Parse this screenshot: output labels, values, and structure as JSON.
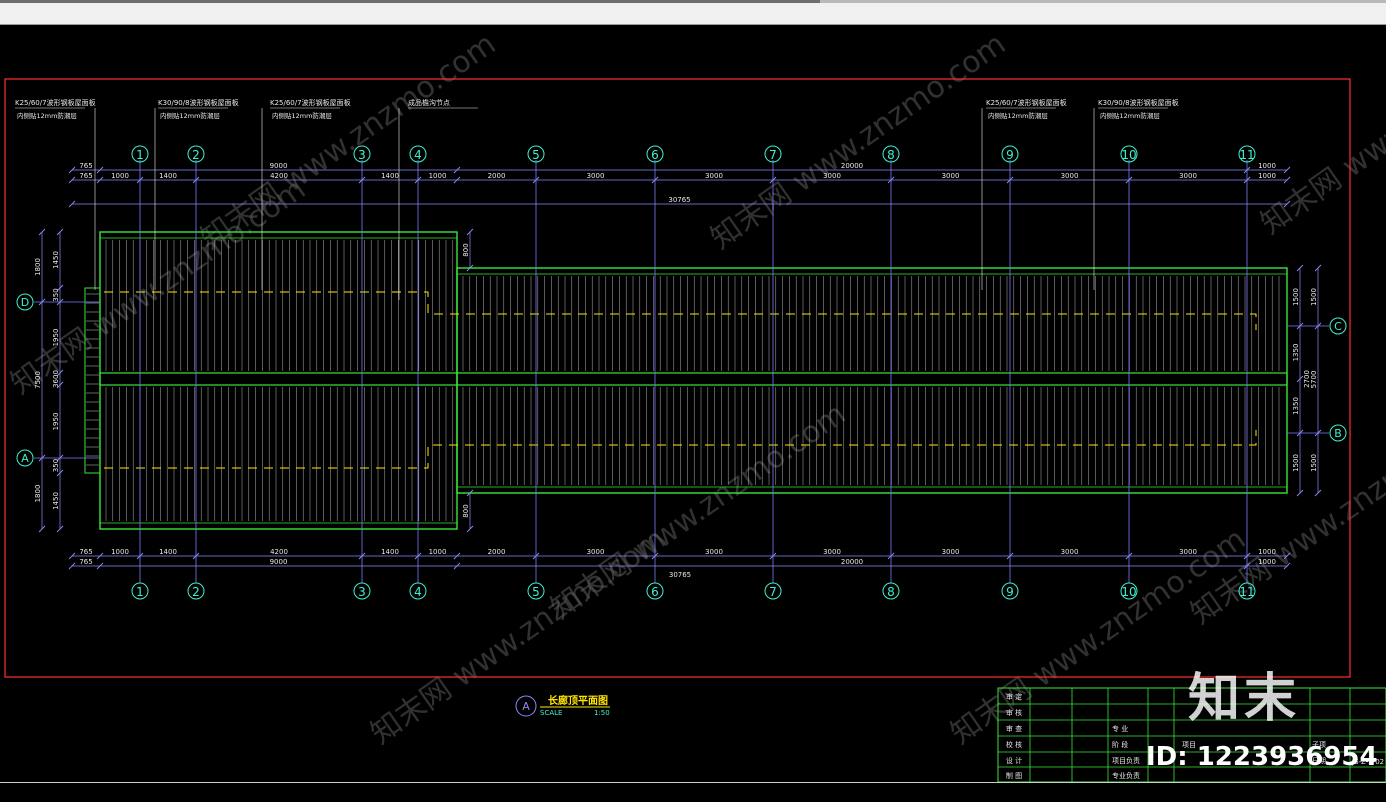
{
  "drawing": {
    "axes_top": [
      "1",
      "2",
      "3",
      "4",
      "5",
      "6",
      "7",
      "8",
      "9",
      "10",
      "11"
    ],
    "axes_bottom": [
      "1",
      "2",
      "3",
      "4",
      "5",
      "6",
      "7",
      "8",
      "9",
      "10",
      "11"
    ],
    "dim_top_row1": [
      "765",
      "9000",
      "20000",
      "1000"
    ],
    "dim_top_row2": [
      "765",
      "1000",
      "1400",
      "4200",
      "1400",
      "1000",
      "2000",
      "3000",
      "3000",
      "3000",
      "3000",
      "3000",
      "3000",
      "1000"
    ],
    "dim_total": "30765",
    "dim_bottom_row1": [
      "765",
      "1000",
      "1400",
      "4200",
      "1400",
      "1000",
      "2000",
      "3000",
      "3000",
      "3000",
      "3000",
      "3000",
      "3000",
      "1000"
    ],
    "dim_bottom_row2": [
      "765",
      "9000",
      "20000",
      "1000"
    ],
    "left_axes": [
      "D",
      "A"
    ],
    "right_axes": [
      "C",
      "B"
    ],
    "left_dims": [
      "1450",
      "1800",
      "350",
      "1950",
      "3600",
      "7500",
      "1950",
      "350",
      "1450",
      "1800"
    ],
    "right_dims": [
      "1500",
      "1500",
      "1350",
      "2700",
      "5700",
      "1350",
      "1500",
      "1500"
    ],
    "step_dims": [
      "800",
      "800"
    ],
    "callouts": [
      {
        "line1": "K25/60/7波形钢板屋面板",
        "line2": "内侧贴12mm防潮层"
      },
      {
        "line1": "K30/90/8波形钢板屋面板",
        "line2": "内侧贴12mm防潮层"
      },
      {
        "line1": "K25/60/7波形钢板屋面板",
        "line2": "内侧贴12mm防潮层"
      },
      {
        "line1": "成品檐沟节点",
        "line2": ""
      },
      {
        "line1": "K25/60/7波形钢板屋面板",
        "line2": "内侧贴12mm防潮层"
      },
      {
        "line1": "K30/90/8波形钢板屋面板",
        "line2": "内侧贴12mm防潮层"
      }
    ],
    "view_title": {
      "mark": "A",
      "name": "长廊顶平面图",
      "scale_label": "SCALE",
      "scale": "1:50"
    }
  },
  "title_block": {
    "left_labels": [
      "审 定",
      "审 核",
      "审 查",
      "校 核",
      "设 计",
      "制 图"
    ],
    "mid_labels": [
      "专 业",
      "阶 段",
      "项目负责",
      "专业负责"
    ],
    "right_labels": [
      "项目",
      "子项",
      "日期"
    ],
    "sheet_no": "JS-Z-5-02"
  },
  "watermark": {
    "text": "知末网 www.znzmo.com"
  },
  "brand": {
    "logo": "知末",
    "id": "ID: 1223936954"
  },
  "colors": {
    "frame": "#ff3030",
    "green": "#39e639",
    "cyan": "#3ef0d0",
    "yellow": "#ffe600",
    "dim": "#7b7bff",
    "white": "#e8e8e8"
  }
}
